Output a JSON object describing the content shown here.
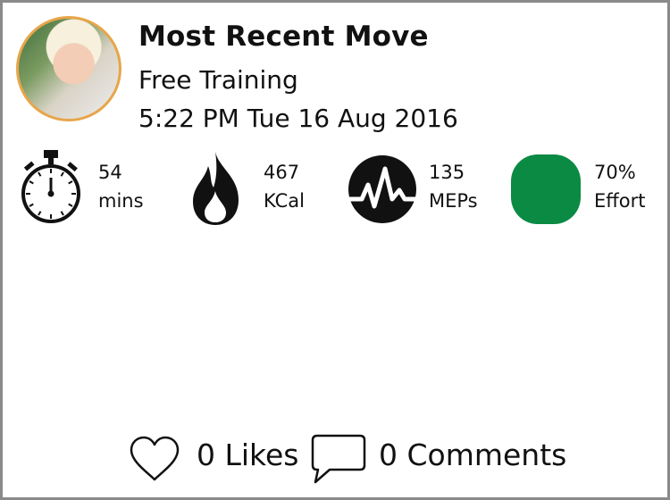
{
  "header": {
    "title": "Most Recent Move",
    "activity": "Free Training",
    "datetime": "5:22 PM Tue 16 Aug 2016"
  },
  "stats": [
    {
      "icon": "stopwatch-icon",
      "value": "54",
      "unit": "mins"
    },
    {
      "icon": "flame-icon",
      "value": "467",
      "unit": "KCal"
    },
    {
      "icon": "heartbeat-icon",
      "value": "135",
      "unit": "MEPs"
    },
    {
      "icon": "effort-zone-icon",
      "value": "70%",
      "unit": "Effort",
      "color": "#0b8a43"
    }
  ],
  "social": {
    "likes_label": "0 Likes",
    "comments_label": "0 Comments"
  },
  "colors": {
    "avatar_ring": "#e7a64a",
    "effort": "#0b8a43",
    "frame": "#8a8a8a"
  }
}
